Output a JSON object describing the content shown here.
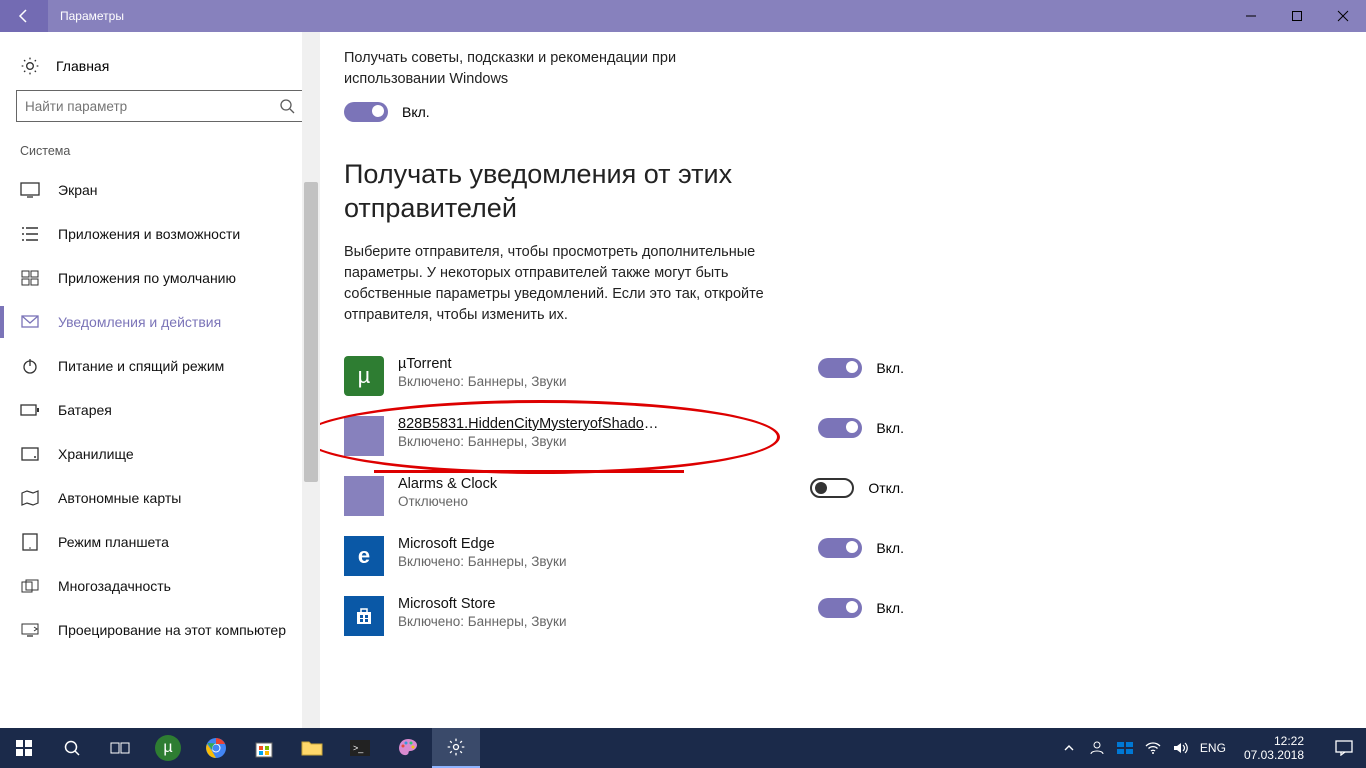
{
  "titlebar": {
    "title": "Параметры"
  },
  "sidebar": {
    "home": "Главная",
    "search_placeholder": "Найти параметр",
    "section": "Система",
    "items": [
      {
        "label": "Экран"
      },
      {
        "label": "Приложения и возможности"
      },
      {
        "label": "Приложения по умолчанию"
      },
      {
        "label": "Уведомления и действия"
      },
      {
        "label": "Питание и спящий режим"
      },
      {
        "label": "Батарея"
      },
      {
        "label": "Хранилище"
      },
      {
        "label": "Автономные карты"
      },
      {
        "label": "Режим планшета"
      },
      {
        "label": "Многозадачность"
      },
      {
        "label": "Проецирование на этот компьютер"
      }
    ]
  },
  "main": {
    "tip_text": "Получать советы, подсказки и рекомендации при использовании Windows",
    "tip_state": "Вкл.",
    "heading": "Получать уведомления от этих отправителей",
    "desc": "Выберите отправителя, чтобы просмотреть дополнительные параметры. У некоторых отправителей также могут быть собственные параметры уведомлений. Если это так, откройте отправителя, чтобы изменить их.",
    "on_label": "Вкл.",
    "off_label": "Откл.",
    "senders": [
      {
        "name": "µTorrent",
        "sub": "Включено: Баннеры, Звуки",
        "on": true,
        "icon": "utorrent"
      },
      {
        "name": "828B5831.HiddenCityMysteryofShadows...",
        "sub": "Включено: Баннеры, Звуки",
        "on": true,
        "icon": "purple",
        "highlight": true
      },
      {
        "name": "Alarms & Clock",
        "sub": "Отключено",
        "on": false,
        "icon": "purple"
      },
      {
        "name": "Microsoft Edge",
        "sub": "Включено: Баннеры, Звуки",
        "on": true,
        "icon": "edge"
      },
      {
        "name": "Microsoft Store",
        "sub": "Включено: Баннеры, Звуки",
        "on": true,
        "icon": "store"
      }
    ]
  },
  "taskbar": {
    "lang": "ENG",
    "time": "12:22",
    "date": "07.03.2018"
  }
}
